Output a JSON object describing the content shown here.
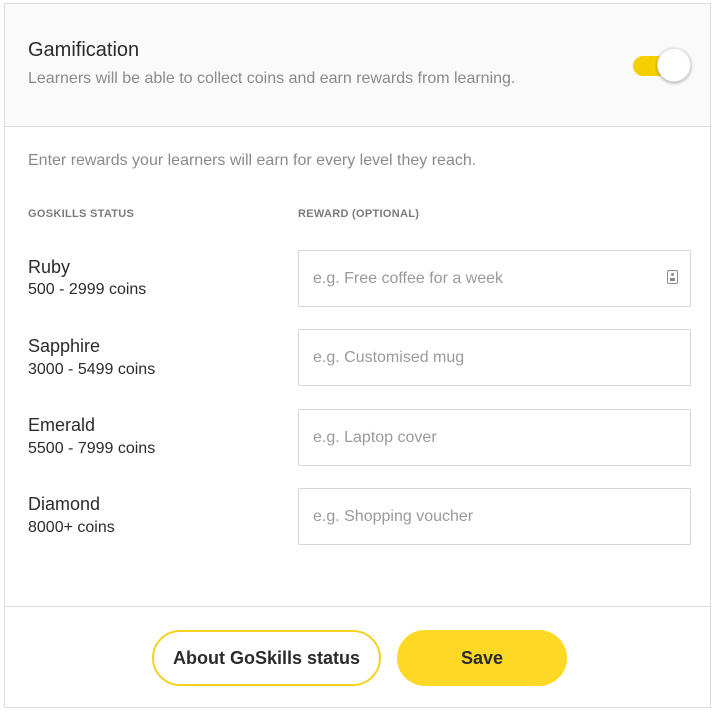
{
  "gamification": {
    "title": "Gamification",
    "description": "Learners will be able to collect coins and earn rewards from learning.",
    "enabled": true,
    "toggle_color": "#F5D000"
  },
  "intro_text": "Enter rewards your learners will earn for every level they reach.",
  "columns": {
    "status": "GOSKILLS STATUS",
    "reward": "REWARD (OPTIONAL)"
  },
  "levels": [
    {
      "name": "Ruby",
      "range": "500 - 2999 coins",
      "reward_value": "",
      "reward_placeholder": "e.g. Free coffee for a week"
    },
    {
      "name": "Sapphire",
      "range": "3000 - 5499 coins",
      "reward_value": "",
      "reward_placeholder": "e.g. Customised mug"
    },
    {
      "name": "Emerald",
      "range": "5500 - 7999 coins",
      "reward_value": "",
      "reward_placeholder": "e.g. Laptop cover"
    },
    {
      "name": "Diamond",
      "range": "8000+ coins",
      "reward_value": "",
      "reward_placeholder": "e.g. Shopping voucher"
    }
  ],
  "input_icon": "contact-card-icon",
  "buttons": {
    "about_label": "About GoSkills status",
    "save_label": "Save",
    "accent": "#FDD824"
  }
}
